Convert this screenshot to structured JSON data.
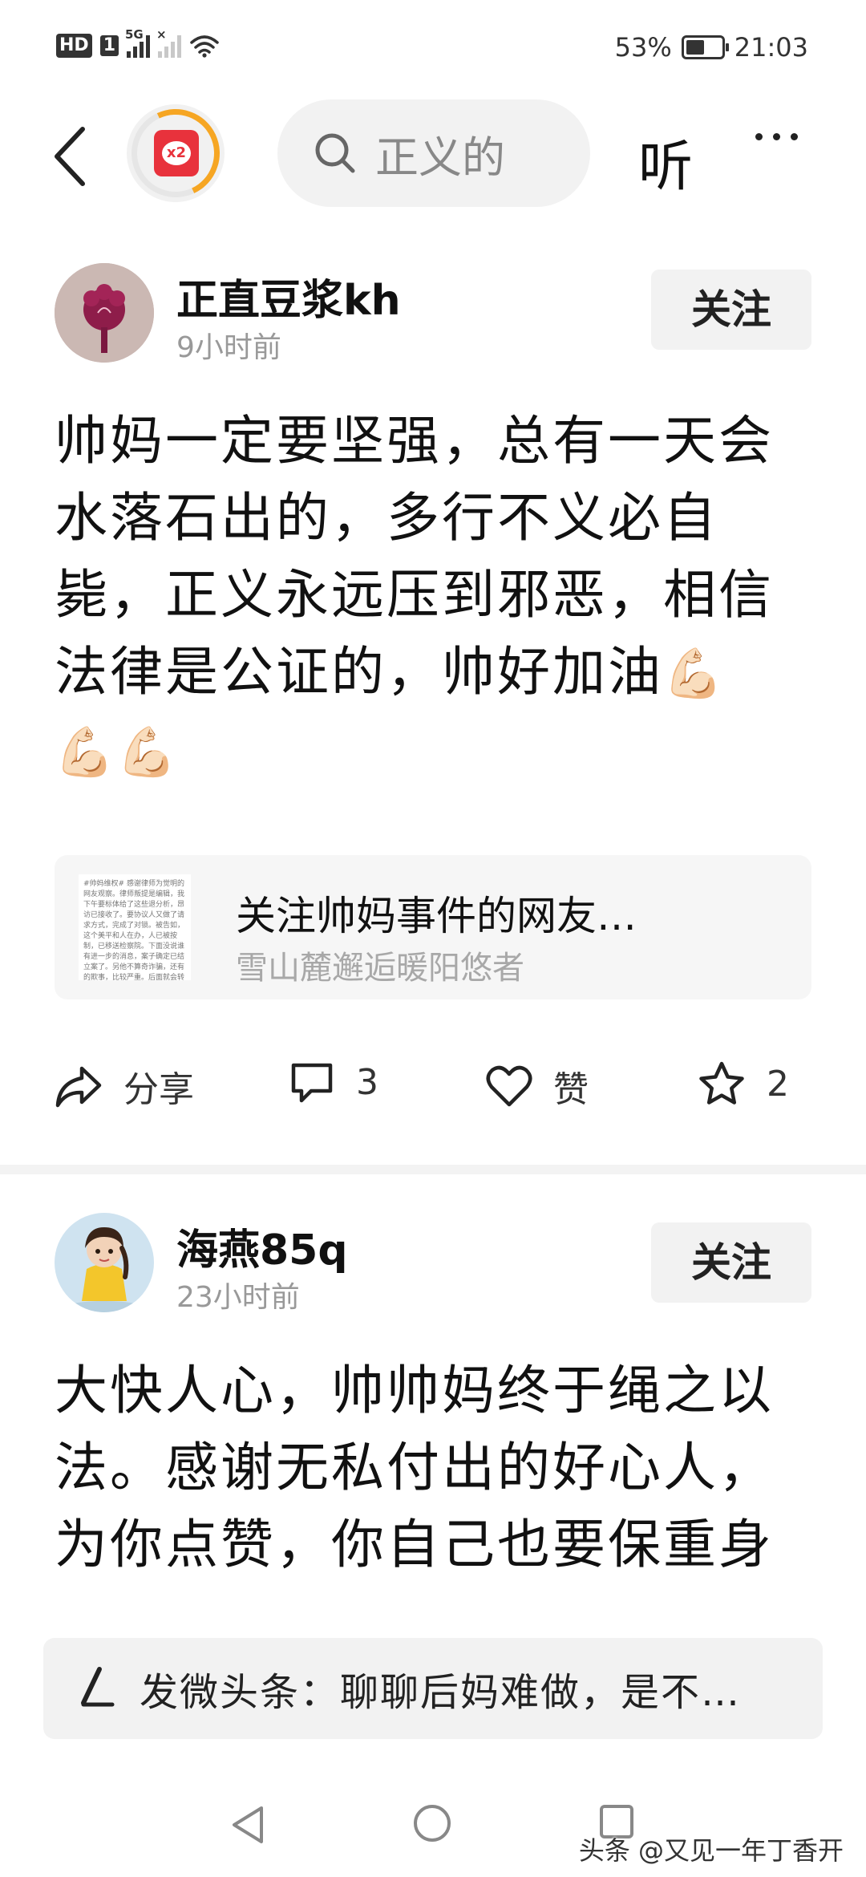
{
  "status_bar": {
    "hd": "HD",
    "sim1": "1",
    "net1": "5G",
    "battery_percent": "53%",
    "battery_level": 0.53,
    "time": "21:03"
  },
  "top_nav": {
    "redpack_label": "x2",
    "search_text": "正义的",
    "listen_label": "听"
  },
  "posts": [
    {
      "user_name": "正直豆浆kh",
      "time": "9小时前",
      "follow_label": "关注",
      "body": "帅妈一定要坚强，总有一天会水落石出的，多行不义必自毙，正义永远压到邪恶，相信法律是公证的，帅好加油",
      "emoji": "💪🏻",
      "emoji_trailing": "💪🏻💪🏻",
      "quote": {
        "title": "关注帅妈事件的网友…",
        "author": "雪山麓邂逅暖阳悠者",
        "thumb_text": "#帅妈维权# 感谢律师为觉明的网友观察。律师叛提是编辑，我下午要标体给了这些退分析，昂访已接收了。要协议人又做了请求方式，完成了对锁。被告如，这个美平和人在办，人已被按制，已移送检察院。下面没说谁有进一步的消息，案子确定已结立案了。另他不算奇诈骗，还有的欺事，比较严重。后面就会转移签说话谁，若到此的防的的说法，都加万了。"
      },
      "actions": {
        "share": "分享",
        "comments": "3",
        "like": "赞",
        "favorites": "2"
      }
    },
    {
      "user_name": "海燕85q",
      "time": "23小时前",
      "follow_label": "关注",
      "body": "大快人心，帅帅妈终于绳之以法。感谢无私付出的好心人，为你点赞，你自己也要保重身"
    }
  ],
  "composer": {
    "text": "发微头条：聊聊后妈难做，是不…"
  },
  "watermark": "头条 @又见一年丁香开"
}
